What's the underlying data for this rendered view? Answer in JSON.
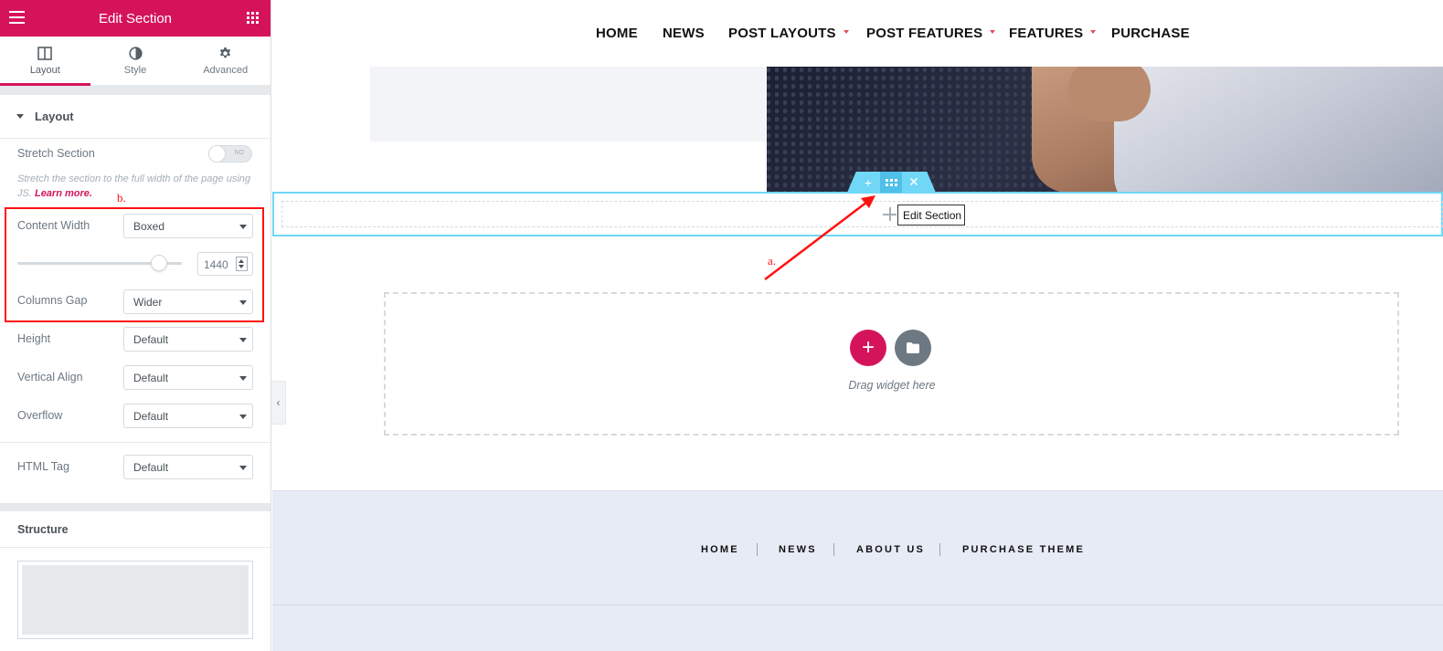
{
  "panel": {
    "title": "Edit Section",
    "tabs": [
      {
        "label": "Layout"
      },
      {
        "label": "Style"
      },
      {
        "label": "Advanced"
      }
    ],
    "section_title": "Layout",
    "stretch_label": "Stretch Section",
    "stretch_toggle": "NO",
    "stretch_desc": "Stretch the section to the full width of the page using JS.",
    "learn_more": "Learn more.",
    "content_width_label": "Content Width",
    "content_width_value": "Boxed",
    "width_number": "1440",
    "columns_gap_label": "Columns Gap",
    "columns_gap_value": "Wider",
    "height_label": "Height",
    "height_value": "Default",
    "valign_label": "Vertical Align",
    "valign_value": "Default",
    "overflow_label": "Overflow",
    "overflow_value": "Default",
    "html_tag_label": "HTML Tag",
    "html_tag_value": "Default",
    "structure_title": "Structure",
    "content_width_slider": 0.86
  },
  "annotations": {
    "a": "a.",
    "b": "b."
  },
  "nav": {
    "items": [
      {
        "label": "HOME"
      },
      {
        "label": "NEWS"
      },
      {
        "label": "POST LAYOUTS"
      },
      {
        "label": "POST FEATURES"
      },
      {
        "label": "FEATURES"
      },
      {
        "label": "PURCHASE"
      }
    ]
  },
  "section_tooltip": "Edit Section",
  "drop_zone_text": "Drag widget here",
  "footer": {
    "links": [
      {
        "label": "HOME"
      },
      {
        "label": "NEWS"
      },
      {
        "label": "ABOUT US"
      },
      {
        "label": "PURCHASE THEME"
      }
    ]
  },
  "colors": {
    "accent": "#d5135b",
    "section_handle": "#71d7f7",
    "annotation": "#ff1111"
  },
  "icons": [
    "hamburger-icon",
    "apps-grid-icon",
    "layout-icon",
    "style-icon",
    "gear-icon",
    "plus-icon",
    "move-icon",
    "close-icon",
    "folder-icon",
    "chevron-left-icon"
  ]
}
